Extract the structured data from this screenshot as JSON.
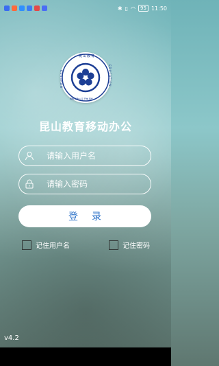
{
  "status_bar": {
    "time": "11:50",
    "battery": "95",
    "notification_icons": [
      "#3a6df0",
      "#ff6a3c",
      "#2f90ff",
      "#3a7df5",
      "#e24a4a",
      "#4a6df5"
    ]
  },
  "logo": {
    "ring_text_top": "昆山教育",
    "ring_text_left": "KUNSHAN",
    "ring_text_right": "EDUCATION",
    "motto": "博雅·精致·公平·开放·现代",
    "brand_color": "#1d3f95"
  },
  "app": {
    "title": "昆山教育移动办公"
  },
  "form": {
    "username_placeholder": "请输入用户名",
    "password_placeholder": "请输入密码",
    "login_label": "登录"
  },
  "options": {
    "remember_user_label": "记住用户名",
    "remember_password_label": "记住密码"
  },
  "footer": {
    "version": "v4.2"
  },
  "colors": {
    "accent": "#2e73c9",
    "background_top": "#6fb3b8",
    "background_bottom": "#5f7770"
  }
}
